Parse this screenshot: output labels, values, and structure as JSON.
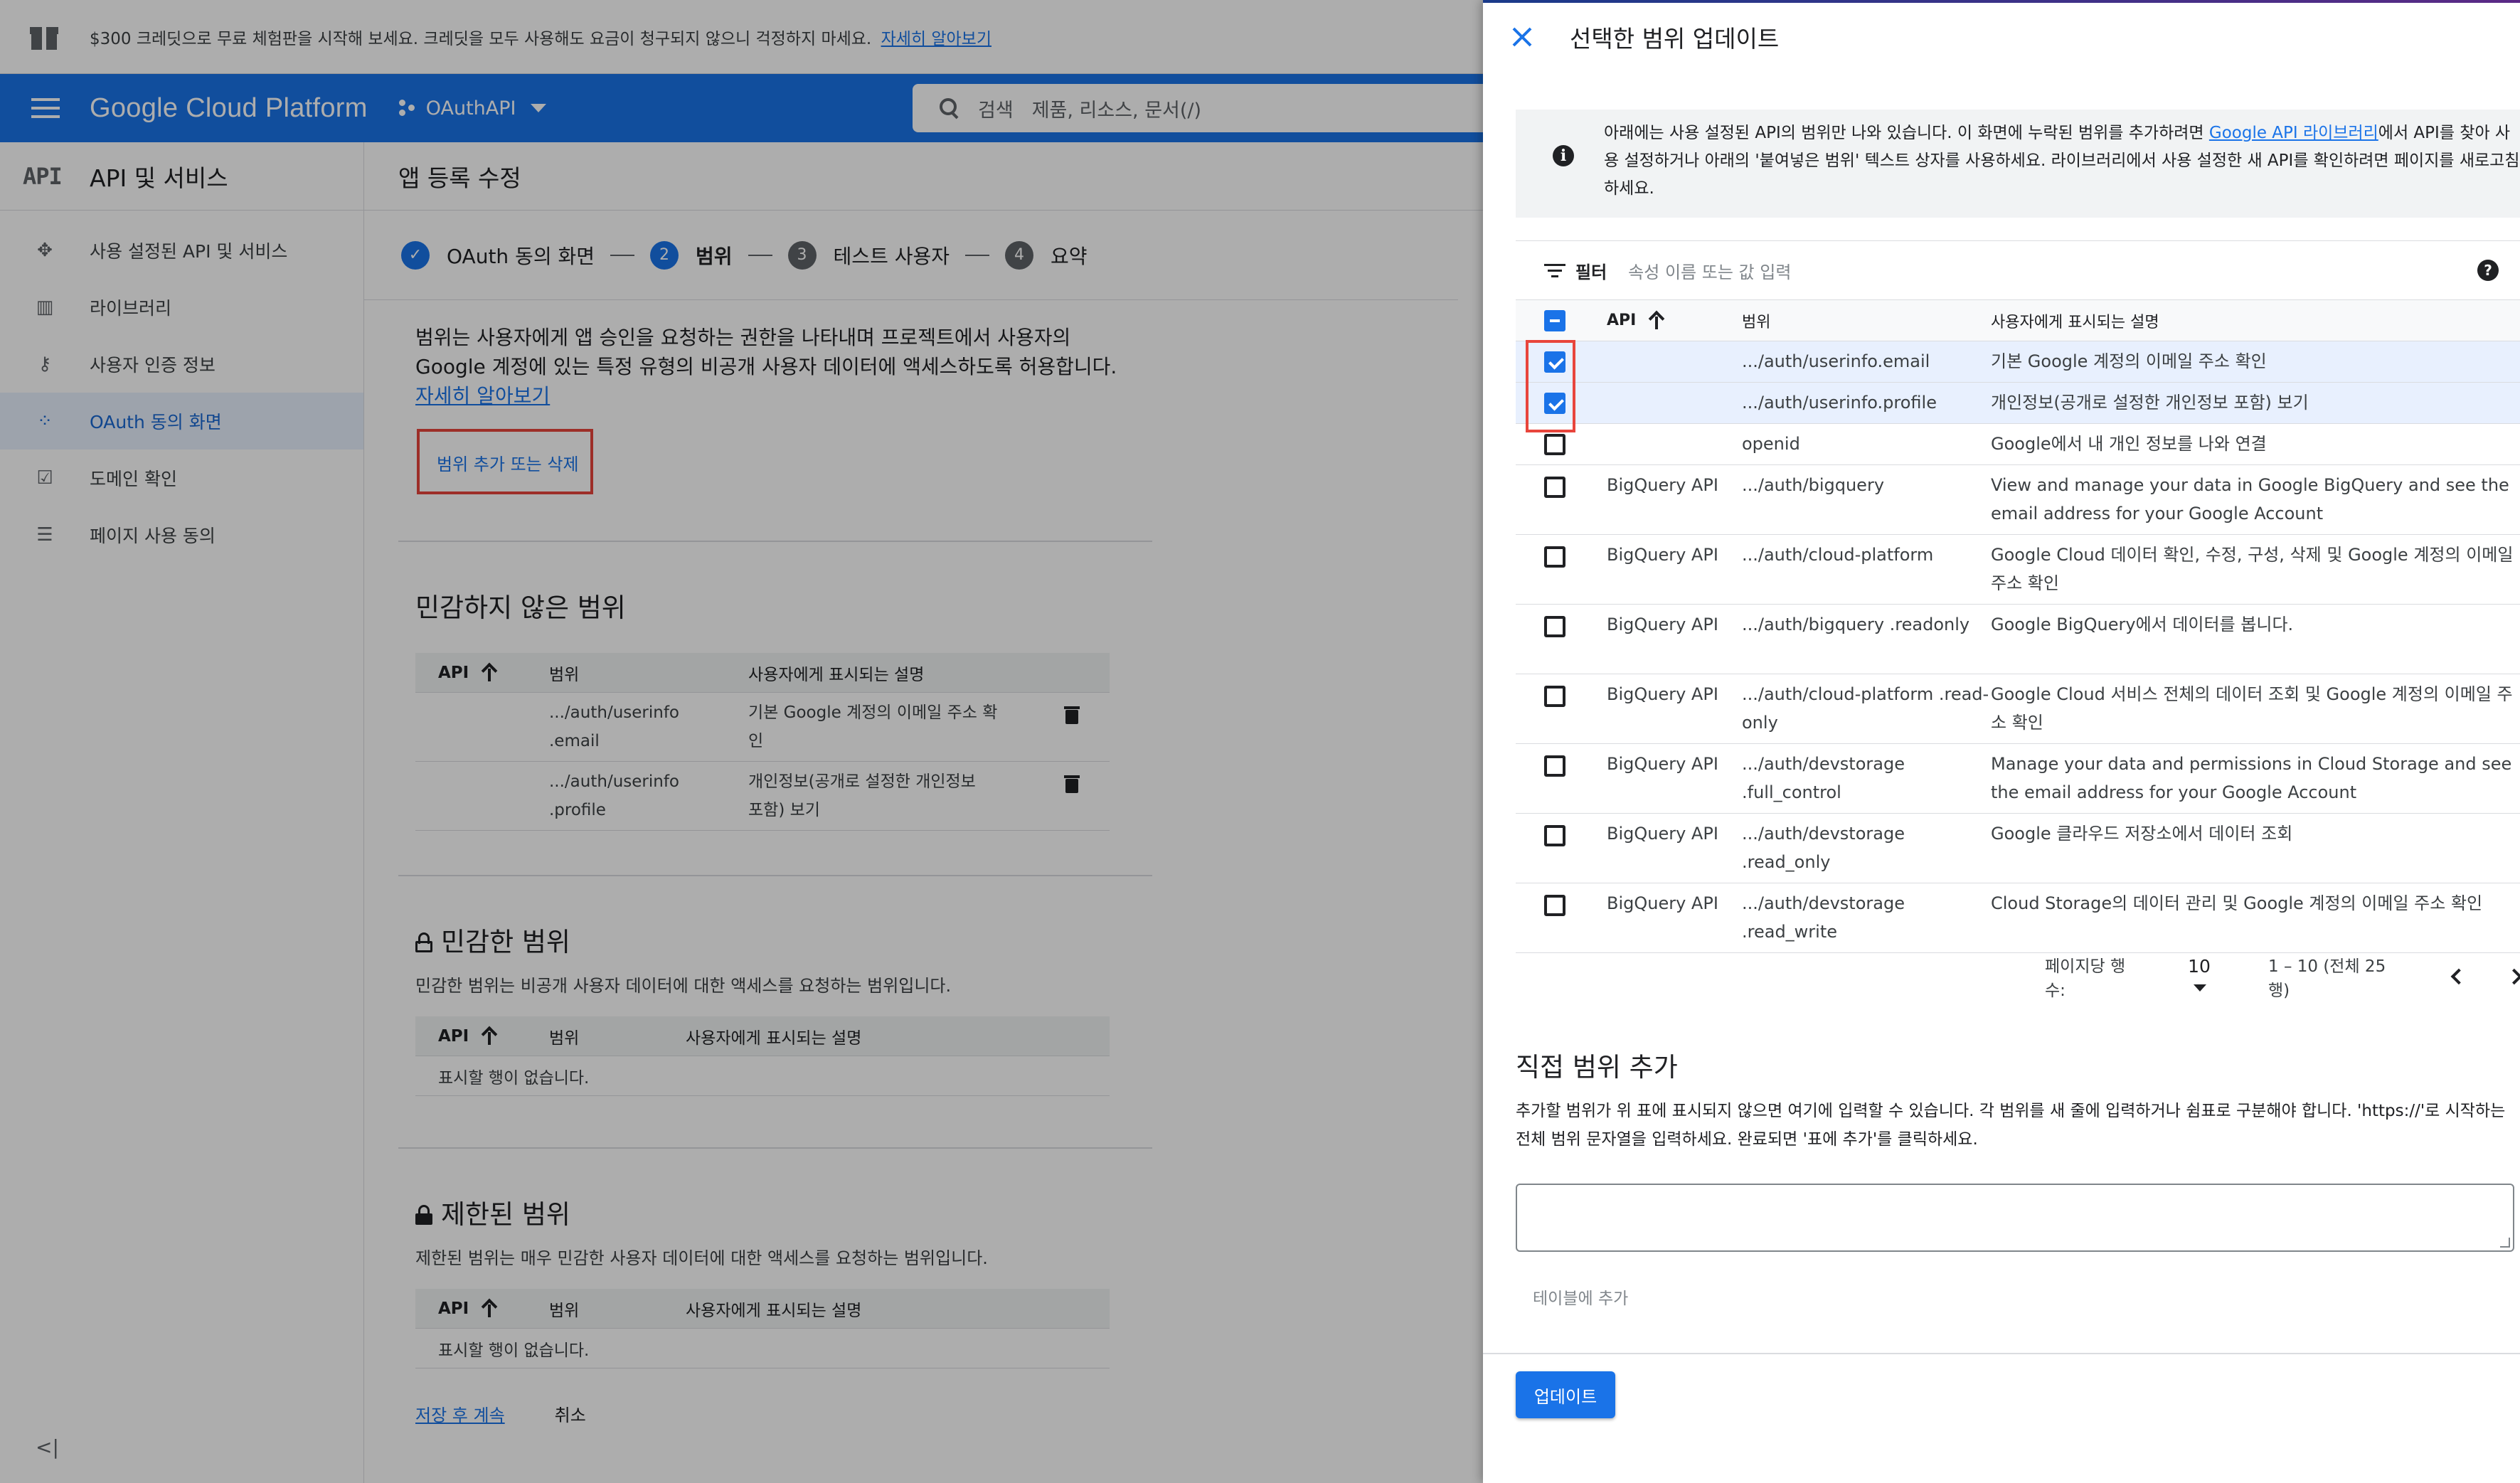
{
  "promo": {
    "text": "$300 크레딧으로 무료 체험판을 시작해 보세요. 크레딧을 모두 사용해도 요금이 청구되지 않으니 걱정하지 마세요.",
    "link": "자세히 알아보기"
  },
  "topbar": {
    "brand": "Google Cloud Platform",
    "project": "OAuthAPI",
    "search_label": "검색",
    "search_placeholder": "제품, 리소스, 문서(/)"
  },
  "sidebar": {
    "logo": "API",
    "title": "API 및 서비스",
    "items": [
      {
        "label": "사용 설정된 API 및 서비스",
        "icon": "api-diamond-icon"
      },
      {
        "label": "라이브러리",
        "icon": "library-icon"
      },
      {
        "label": "사용자 인증 정보",
        "icon": "key-icon"
      },
      {
        "label": "OAuth 동의 화면",
        "icon": "oauth-dots-icon",
        "active": true
      },
      {
        "label": "도메인 확인",
        "icon": "checkbox-icon"
      },
      {
        "label": "페이지 사용 동의",
        "icon": "settings-list-icon"
      }
    ],
    "collapse": "<|"
  },
  "main": {
    "title": "앱 등록 수정",
    "steps": [
      {
        "num": "✓",
        "label": "OAuth 동의 화면"
      },
      {
        "num": "2",
        "label": "범위"
      },
      {
        "num": "3",
        "label": "테스트 사용자"
      },
      {
        "num": "4",
        "label": "요약"
      }
    ],
    "desc_line1": "범위는 사용자에게 앱 승인을 요청하는 권한을 나타내며 프로젝트에서 사용자의",
    "desc_line2": "Google 계정에 있는 특정 유형의 비공개 사용자 데이터에 액세스하도록 허용합니다.",
    "desc_link": "자세히 알아보기",
    "add_remove": "범위 추가 또는 삭제",
    "nonsensitive": {
      "title": "민감하지 않은 범위",
      "cols": [
        "API",
        "범위",
        "사용자에게 표시되는 설명"
      ],
      "rows": [
        {
          "scope1": ".../auth/userinfo",
          "scope2": ".email",
          "desc1": "기본 Google 계정의 이메일 주소 확",
          "desc2": "인"
        },
        {
          "scope1": ".../auth/userinfo",
          "scope2": ".profile",
          "desc1": "개인정보(공개로 설정한 개인정보",
          "desc2": "포함) 보기"
        }
      ]
    },
    "sensitive": {
      "title": "민감한 범위",
      "sub": "민감한 범위는 비공개 사용자 데이터에 대한 액세스를 요청하는 범위입니다.",
      "cols": [
        "API",
        "범위",
        "사용자에게 표시되는 설명"
      ],
      "empty": "표시할 행이 없습니다."
    },
    "restricted": {
      "title": "제한된 범위",
      "sub": "제한된 범위는 매우 민감한 사용자 데이터에 대한 액세스를 요청하는 범위입니다.",
      "cols": [
        "API",
        "범위",
        "사용자에게 표시되는 설명"
      ],
      "empty": "표시할 행이 없습니다."
    },
    "footer_save": "저장 후 계속",
    "footer_cancel": "취소"
  },
  "drawer": {
    "title": "선택한 범위 업데이트",
    "info_a": "아래에는 사용 설정된 API의 범위만 나와 있습니다. 이 화면에 누락된 범위를 추가하려면 ",
    "info_link": "Google API 라이브러리",
    "info_b": "에서 API를 찾아 사용 설정하거나 아래의 '붙여넣은 범위' 텍스트 상자를 사용하세요. 라이브러리에서 사용 설정한 새 API를 확인하려면 페이지를 새로고침하세요.",
    "filter_label": "필터",
    "filter_placeholder": "속성 이름 또는 값 입력",
    "cols": {
      "api": "API",
      "scope": "범위",
      "desc": "사용자에게 표시되는 설명"
    },
    "rows": [
      {
        "checked": true,
        "api": "",
        "scope": ".../auth/userinfo.email",
        "desc": "기본 Google 계정의 이메일 주소 확인"
      },
      {
        "checked": true,
        "api": "",
        "scope": ".../auth/userinfo.profile",
        "desc": "개인정보(공개로 설정한 개인정보 포함) 보기"
      },
      {
        "checked": false,
        "api": "",
        "scope": "openid",
        "desc": "Google에서 내 개인 정보를 나와 연결"
      },
      {
        "checked": false,
        "api": "BigQuery API",
        "scope": ".../auth/bigquery",
        "desc": "View and manage your data in Google BigQuery and see the email address for your Google Account"
      },
      {
        "checked": false,
        "api": "BigQuery API",
        "scope": ".../auth/cloud-platform",
        "desc": "Google Cloud 데이터 확인, 수정, 구성, 삭제 및 Google 계정의 이메일 주소 확인"
      },
      {
        "checked": false,
        "api": "BigQuery API",
        "scope": ".../auth/bigquery .readonly",
        "desc": "Google BigQuery에서 데이터를 봅니다."
      },
      {
        "checked": false,
        "api": "BigQuery API",
        "scope": ".../auth/cloud-platform .read-only",
        "desc": "Google Cloud 서비스 전체의 데이터 조회 및 Google 계정의 이메일 주소 확인"
      },
      {
        "checked": false,
        "api": "BigQuery API",
        "scope": ".../auth/devstorage .full_control",
        "desc": "Manage your data and permissions in Cloud Storage and see the email address for your Google Account"
      },
      {
        "checked": false,
        "api": "BigQuery API",
        "scope": ".../auth/devstorage .read_only",
        "desc": "Google 클라우드 저장소에서 데이터 조회"
      },
      {
        "checked": false,
        "api": "BigQuery API",
        "scope": ".../auth/devstorage .read_write",
        "desc": "Cloud Storage의 데이터 관리 및 Google 계정의 이메일 주소 확인"
      }
    ],
    "pager": {
      "label": "페이지당 행 수:",
      "per_page": "10",
      "range": "1 – 10 (전체 25행)"
    },
    "manual_title": "직접 범위 추가",
    "manual_desc": "추가할 범위가 위 표에 표시되지 않으면 여기에 입력할 수 있습니다. 각 범위를 새 줄에 입력하거나 쉼표로 구분해야 합니다. 'https://'로 시작하는 전체 범위 문자열을 입력하세요. 완료되면 '표에 추가'를 클릭하세요.",
    "add_to_table": "테이블에 추가",
    "update_button": "업데이트"
  },
  "colors": {
    "accent": "#1a73e8",
    "highlight": "#e8453c",
    "selected_row": "#e8f0fe"
  }
}
